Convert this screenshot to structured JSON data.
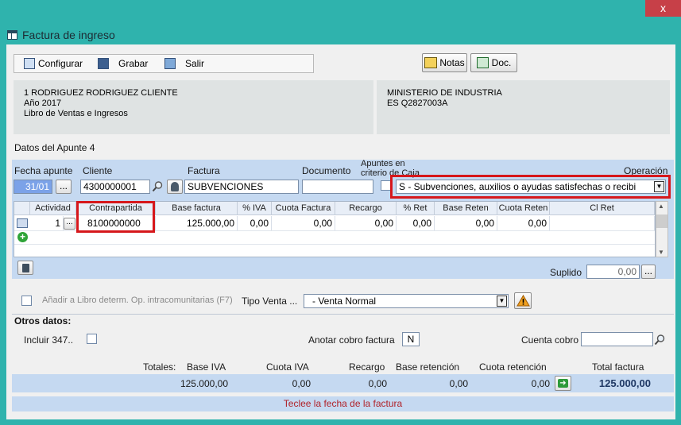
{
  "window": {
    "title": "Factura de ingreso",
    "close_glyph": "x"
  },
  "toolbar": {
    "configurar": "Configurar",
    "grabar": "Grabar",
    "salir": "Salir",
    "notas": "Notas",
    "doc": "Doc."
  },
  "client_info": {
    "line1": "1 RODRIGUEZ RODRIGUEZ CLIENTE",
    "line2": "Año 2017",
    "line3": "Libro de Ventas e Ingresos"
  },
  "ministry_info": {
    "line1": "MINISTERIO DE INDUSTRIA",
    "line2": "ES Q2827003A"
  },
  "section": {
    "apunte": "Datos del Apunte 4",
    "otros": "Otros datos:"
  },
  "header_fields": {
    "fecha_label": "Fecha apunte",
    "fecha_value": "31/01",
    "ellipsis": "...",
    "cliente_label": "Cliente",
    "cliente_value": "4300000001",
    "factura_label": "Factura",
    "factura_value": "SUBVENCIONES",
    "documento_label": "Documento",
    "documento_value": "",
    "apuntes_label": "Apuntes en criterio de Caja",
    "operacion_label": "Operación",
    "operacion_value": "S - Subvenciones, auxilios o ayudas satisfechas o recibi"
  },
  "grid": {
    "headers": [
      "Actividad",
      "Contrapartida",
      "Base factura",
      "% IVA",
      "Cuota Factura",
      "Recargo",
      "% Ret",
      "Base Reten",
      "Cuota Reten",
      "Cl Ret"
    ],
    "row": {
      "actividad": "1",
      "ellipsis": "...",
      "contrapartida": "8100000000",
      "base": "125.000,00",
      "iva": "0,00",
      "cuota": "0,00",
      "recargo": "0,00",
      "ret": "0,00",
      "base_reten": "0,00",
      "cuota_reten": "0,00",
      "cl_ret": ""
    }
  },
  "suplido": {
    "label": "Suplido",
    "value": "0,00",
    "ellipsis": "..."
  },
  "libro": {
    "label": "Añadir a Libro determ. Op. intracomunitarias (F7)"
  },
  "tipo_venta": {
    "label": "Tipo Venta ...",
    "value": "- Venta Normal"
  },
  "otros": {
    "incluir_label": "Incluir 347..",
    "anotar_label": "Anotar cobro factura",
    "anotar_value": "N",
    "cuenta_label": "Cuenta cobro",
    "cuenta_value": ""
  },
  "totales": {
    "label": "Totales:",
    "base_iva_label": "Base IVA",
    "cuota_iva_label": "Cuota IVA",
    "recargo_label": "Recargo",
    "base_ret_label": "Base retención",
    "cuota_ret_label": "Cuota retención",
    "total_label": "Total factura",
    "base_iva": "125.000,00",
    "cuota_iva": "0,00",
    "recargo": "0,00",
    "base_ret": "0,00",
    "cuota_ret": "0,00",
    "total": "125.000,00"
  },
  "status": {
    "message": "Teclee la fecha de la factura"
  },
  "colors": {
    "accent": "#c5d9f1",
    "highlight": "#d6171b",
    "titlebar": "#2fb3ad"
  }
}
